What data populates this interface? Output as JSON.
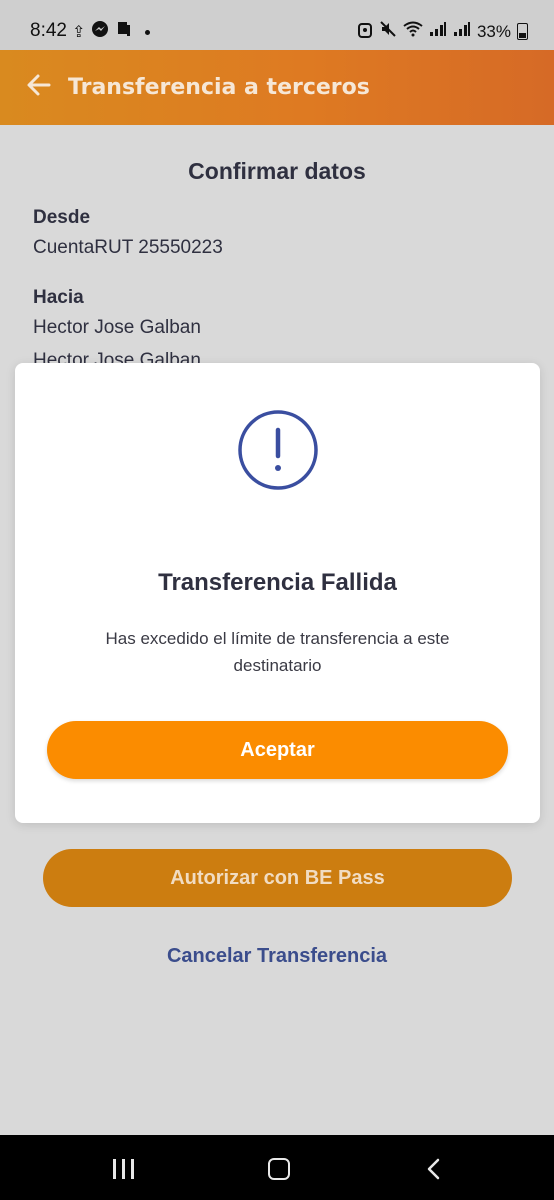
{
  "status_bar": {
    "time": "8:42",
    "battery": "33%",
    "icons": [
      "upload-icon",
      "messenger-icon",
      "notification-icon",
      "alarm-icon",
      "mute-icon",
      "wifi-icon",
      "signal-icon",
      "signal-icon",
      "battery-icon"
    ]
  },
  "header": {
    "title": "Transferencia a terceros",
    "back_icon": "arrow-left-icon",
    "colors": {
      "start": "#d98a1f",
      "end": "#d66a26",
      "title": "#f6e7d6"
    }
  },
  "confirm": {
    "title": "Confirmar datos",
    "from_label": "Desde",
    "from_value": "CuentaRUT 25550223",
    "to_label": "Hacia",
    "to_name": "Hector Jose Galban",
    "to_name_repeat": "Hector Jose Galban"
  },
  "modal": {
    "icon": "exclamation-circle-icon",
    "title": "Transferencia Fallida",
    "message": "Has excedido el límite de transferencia a este destinatario",
    "accept_label": "Aceptar",
    "colors": {
      "accent": "#fb8c00",
      "icon": "#3a4ea0"
    }
  },
  "actions": {
    "authorize_label": "Autorizar con BE Pass",
    "cancel_label": "Cancelar Transferencia"
  },
  "nav_bar": {
    "icons": [
      "recents-icon",
      "home-icon",
      "back-icon"
    ]
  }
}
